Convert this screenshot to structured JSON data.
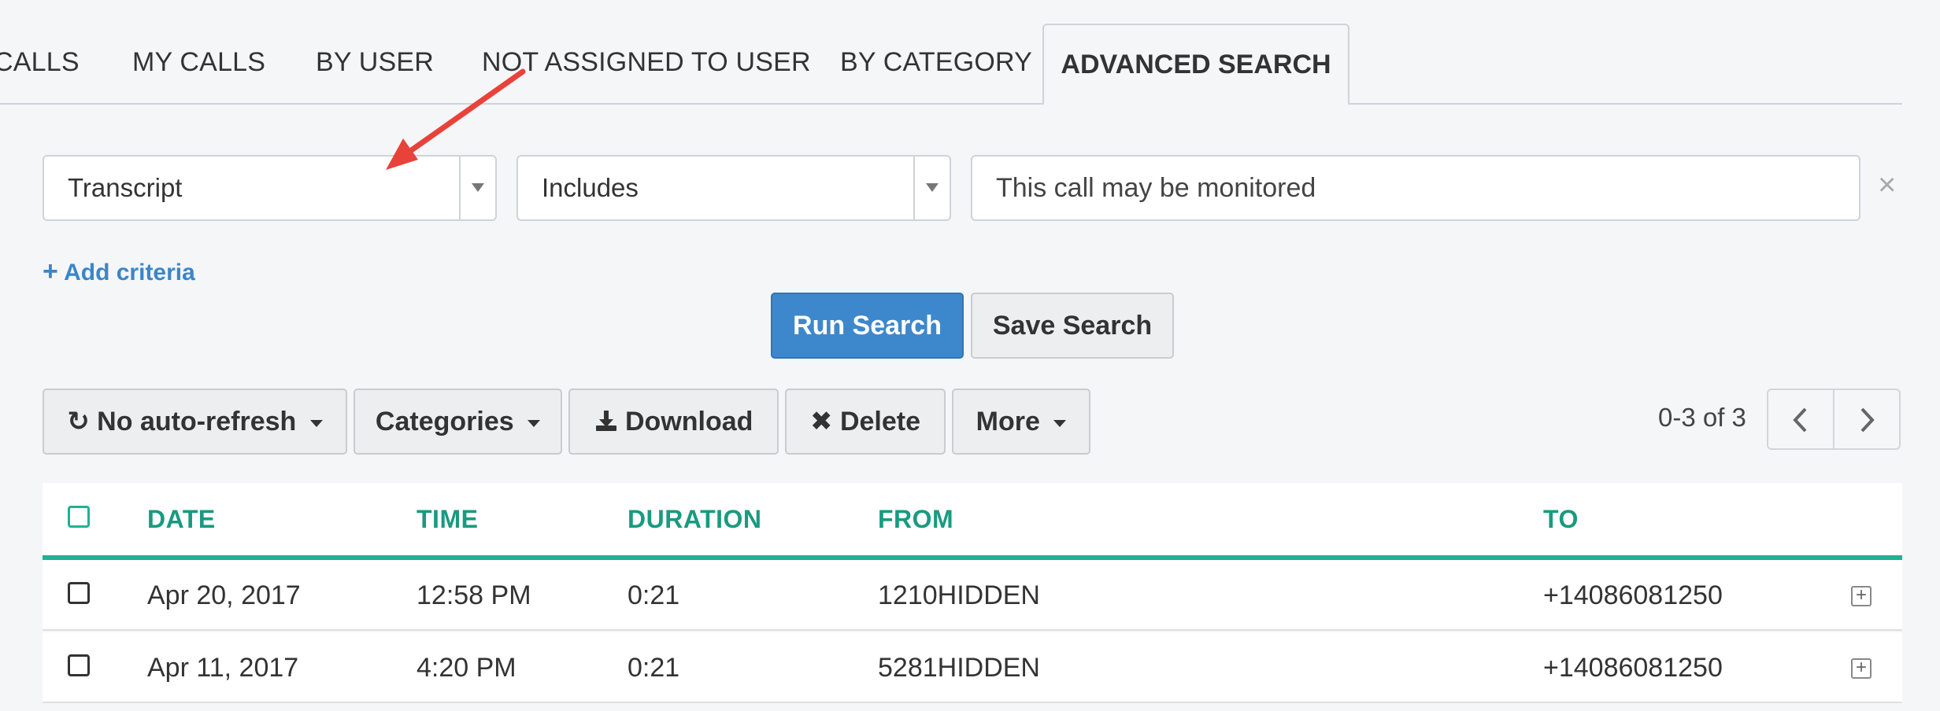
{
  "tabs": [
    {
      "label": "CALLS"
    },
    {
      "label": "MY CALLS"
    },
    {
      "label": "BY USER"
    },
    {
      "label": "NOT ASSIGNED TO USER"
    },
    {
      "label": "BY CATEGORY"
    },
    {
      "label": "ADVANCED SEARCH"
    }
  ],
  "criteria": {
    "field_value": "Transcript",
    "operator_value": "Includes",
    "query_value": "This call may be monitored",
    "clear_label": "×"
  },
  "add_criteria_label": "Add criteria",
  "actions": {
    "run_search": "Run Search",
    "save_search": "Save Search"
  },
  "toolbar": {
    "auto_refresh": "No auto-refresh",
    "categories": "Categories",
    "download": "Download",
    "delete": "Delete",
    "more": "More"
  },
  "pagination": {
    "text": "0-3 of 3",
    "prev_icon": "chevron-left-icon",
    "next_icon": "chevron-right-icon"
  },
  "table": {
    "columns": [
      "DATE",
      "TIME",
      "DURATION",
      "FROM",
      "TO"
    ],
    "rows": [
      {
        "date": "Apr 20, 2017",
        "time": "12:58 PM",
        "duration": "0:21",
        "from": "1210HIDDEN",
        "to": "+14086081250"
      },
      {
        "date": "Apr 11, 2017",
        "time": "4:20 PM",
        "duration": "0:21",
        "from": "5281HIDDEN",
        "to": "+14086081250"
      }
    ]
  },
  "colors": {
    "accent_teal": "#1fb294",
    "primary_blue": "#3d88cc",
    "link_blue": "#3a86c8",
    "arrow_red": "#e8423a"
  }
}
